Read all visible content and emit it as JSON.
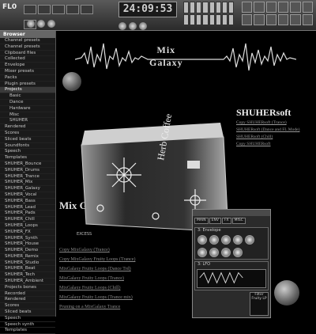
{
  "toolbar": {
    "app_logo": "FL0",
    "clock": "24:09:53"
  },
  "browser": {
    "header": "Browser",
    "items": [
      {
        "label": "Channel presets",
        "sel": false
      },
      {
        "label": "Channel presets",
        "sel": false
      },
      {
        "label": "Clipboard files",
        "sel": false
      },
      {
        "label": "Collected",
        "sel": false
      },
      {
        "label": "Envelope",
        "sel": false
      },
      {
        "label": "Mixer presets",
        "sel": false
      },
      {
        "label": "Packs",
        "sel": false
      },
      {
        "label": "Plugin presets",
        "sel": false
      },
      {
        "label": "Projects",
        "sel": true
      },
      {
        "label": "Basic",
        "sel": false,
        "indent": true
      },
      {
        "label": "Dance",
        "sel": false,
        "indent": true
      },
      {
        "label": "Hardware",
        "sel": false,
        "indent": true
      },
      {
        "label": "Misc",
        "sel": false,
        "indent": true
      },
      {
        "label": "SHUHER",
        "sel": false,
        "indent": true
      },
      {
        "label": "Rendered",
        "sel": false
      },
      {
        "label": "Scores",
        "sel": false
      },
      {
        "label": "Sliced beats",
        "sel": false
      },
      {
        "label": "Soundfonts",
        "sel": false
      },
      {
        "label": "Speech",
        "sel": false
      },
      {
        "label": "Templates",
        "sel": false
      },
      {
        "label": "SHUHER_Bounce",
        "sel": false
      },
      {
        "label": "SHUHER_Drums",
        "sel": false
      },
      {
        "label": "SHUHER_Trance",
        "sel": false
      },
      {
        "label": "SHUHER_Mix",
        "sel": false
      },
      {
        "label": "SHUHER_Galaxy",
        "sel": false
      },
      {
        "label": "SHUHER_Vocal",
        "sel": false
      },
      {
        "label": "SHUHER_Bass",
        "sel": false
      },
      {
        "label": "SHUHER_Lead",
        "sel": false
      },
      {
        "label": "SHUHER_Pads",
        "sel": false
      },
      {
        "label": "SHUHER_Chill",
        "sel": false
      },
      {
        "label": "SHUHER_Loops",
        "sel": false
      },
      {
        "label": "SHUHER_FX",
        "sel": false
      },
      {
        "label": "SHUHER_Synth",
        "sel": false
      },
      {
        "label": "SHUHER_House",
        "sel": false
      },
      {
        "label": "SHUHER_Demo",
        "sel": false
      },
      {
        "label": "SHUHER_Remix",
        "sel": false
      },
      {
        "label": "SHUHER_Studio",
        "sel": false
      },
      {
        "label": "SHUHER_Beat",
        "sel": false
      },
      {
        "label": "SHUHER_Tech",
        "sel": false
      },
      {
        "label": "SHUHER_Ambient",
        "sel": false
      },
      {
        "label": "Projects bones",
        "sel": false
      },
      {
        "label": "Recorded",
        "sel": false
      },
      {
        "label": "Rendered",
        "sel": false
      },
      {
        "label": "Scores",
        "sel": false
      },
      {
        "label": "Sliced beats",
        "sel": false
      },
      {
        "label": "Speech",
        "sel": false
      },
      {
        "label": "Speech synth",
        "sel": false
      },
      {
        "label": "Templates",
        "sel": false
      }
    ]
  },
  "site": {
    "title_line1": "Mix",
    "title_line2": "Galaxy",
    "shuher_title": "SHUHERsoft",
    "shuher_links": [
      "Copy SHUHERsoft (Trance)",
      "SHUHERsoft (Dance and FL Mode)",
      "SHUHERsoft (Chill)",
      "Copy SHUHERsoft"
    ],
    "mix_title": "Mix G",
    "mix_links": [
      "Copy MixGalaxy (Trance)",
      "Copy MixGalaxy Fruity Loops (Trance)",
      "MixGalaxy Fruity Loops (Dance Trd)",
      "MixGalaxy Fruity Loops (Trance)",
      "MixGalaxy Fruity Loops (Chill)",
      "MixGalaxy Fruity Loops (Trance mix)",
      "Pruning on a MixGalaxy Trance"
    ],
    "mug_label_left": "EXCESS",
    "mug_label_right": "Herb Coffee"
  },
  "plugin": {
    "title": "",
    "tabs": [
      "MAIN",
      "ENV",
      "FX",
      "MISC"
    ],
    "section1_label": "3: Envelope",
    "section2_label": "3: LFO",
    "side_label": "Filter",
    "side_value": "Fruity LP"
  }
}
